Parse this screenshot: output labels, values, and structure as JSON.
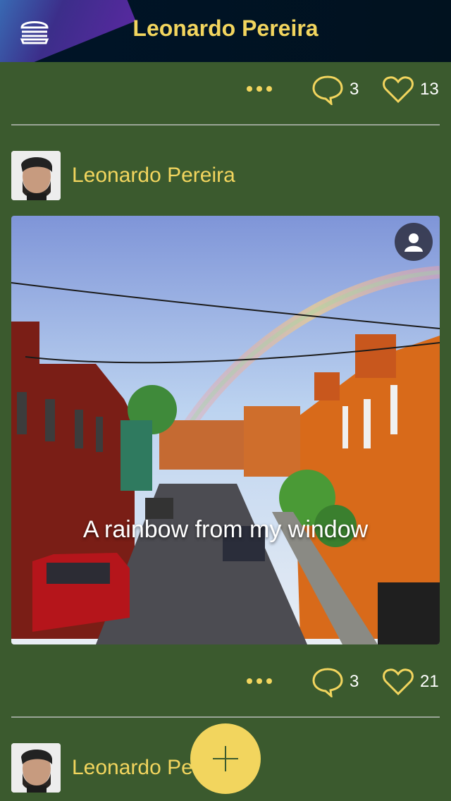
{
  "header": {
    "title": "Leonardo Pereira",
    "menu_icon": "hamburger-icon"
  },
  "feed": {
    "top_post_stats": {
      "comments": "3",
      "likes": "13"
    },
    "post": {
      "author": "Leonardo Pereira",
      "caption": "A rainbow from my window",
      "comments": "3",
      "likes": "21"
    },
    "next_post": {
      "author": "Leonardo Pereira"
    }
  },
  "colors": {
    "accent": "#f2d55e",
    "background": "#3b5a2e",
    "header": "#001428"
  }
}
